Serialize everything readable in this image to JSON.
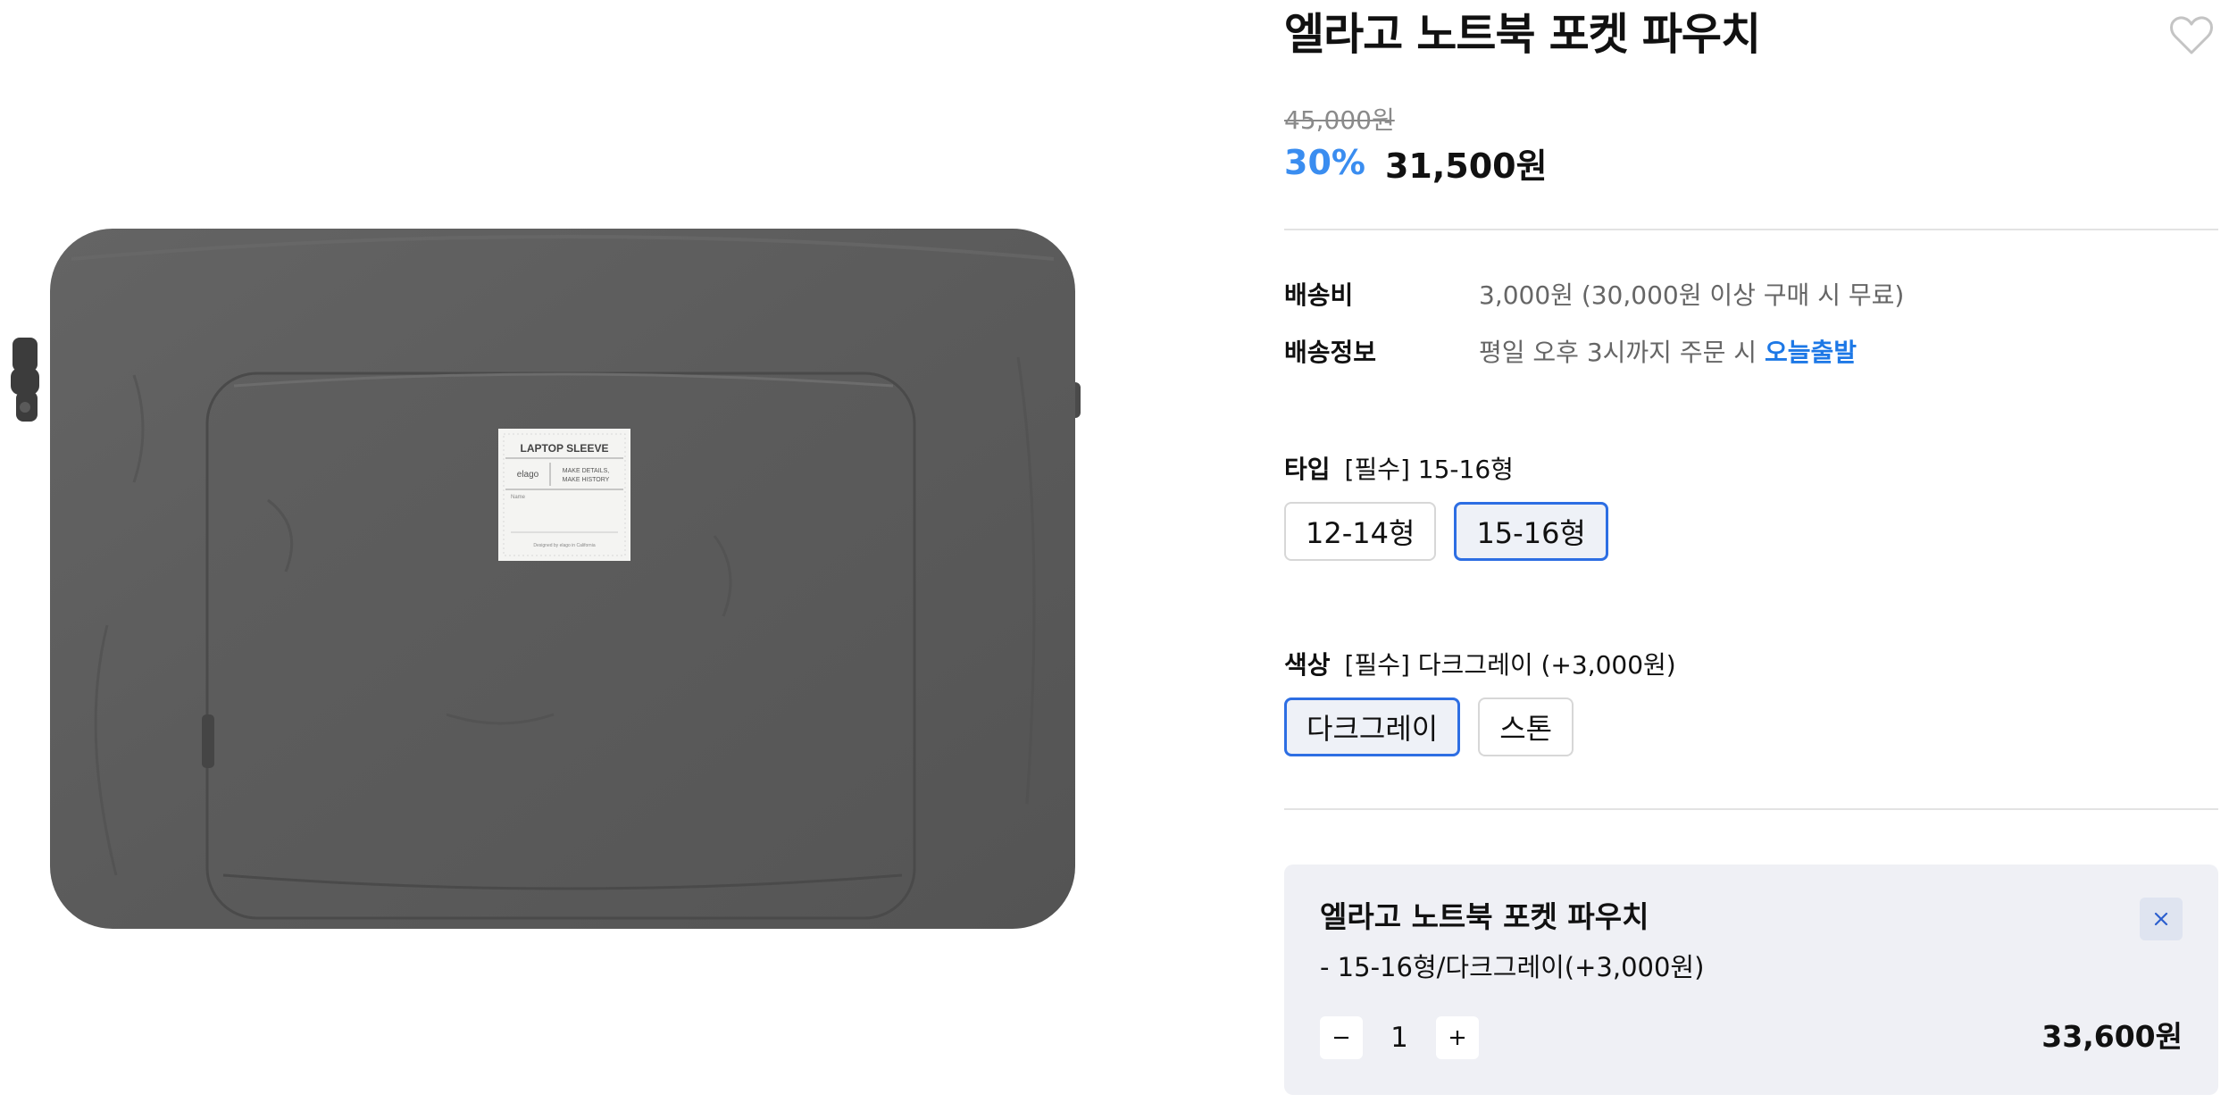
{
  "product": {
    "title": "엘라고 노트북 포켓 파우치",
    "original_price": "45,000원",
    "discount": "30%",
    "sale_price": "31,500원",
    "wishlist_icon": "heart-outline-icon",
    "image_label": {
      "heading": "LAPTOP SLEEVE",
      "brand": "elago",
      "tagline_1": "MAKE DETAILS,",
      "tagline_2": "MAKE HISTORY",
      "name_field": "Name",
      "footer": "Designed by elago in California"
    }
  },
  "shipping": {
    "fee_label": "배송비",
    "fee_value": "3,000원 (30,000원 이상 구매 시 무료)",
    "info_label": "배송정보",
    "info_value": "평일 오후 3시까지 주문 시",
    "info_highlight": "오늘출발"
  },
  "options": {
    "type": {
      "label": "타입",
      "selected_text": "[필수] 15-16형",
      "choices": [
        "12-14형",
        "15-16형"
      ],
      "active_index": 1
    },
    "color": {
      "label": "색상",
      "selected_text": "[필수] 다크그레이 (+3,000원)",
      "choices": [
        "다크그레이",
        "스톤"
      ],
      "active_index": 0
    }
  },
  "selected_item": {
    "title": "엘라고 노트북 포켓 파우치",
    "option_line": "- 15-16형/다크그레이(+3,000원)",
    "quantity": "1",
    "total": "33,600원",
    "close_icon": "close-icon",
    "minus_icon": "minus-icon",
    "plus_icon": "plus-icon"
  },
  "colors": {
    "accent": "#3a8df0",
    "link": "#1d78e6",
    "active_border": "#2d6ee3",
    "panel_bg": "#eff0f5",
    "product_fabric": "#5c5c5c"
  }
}
